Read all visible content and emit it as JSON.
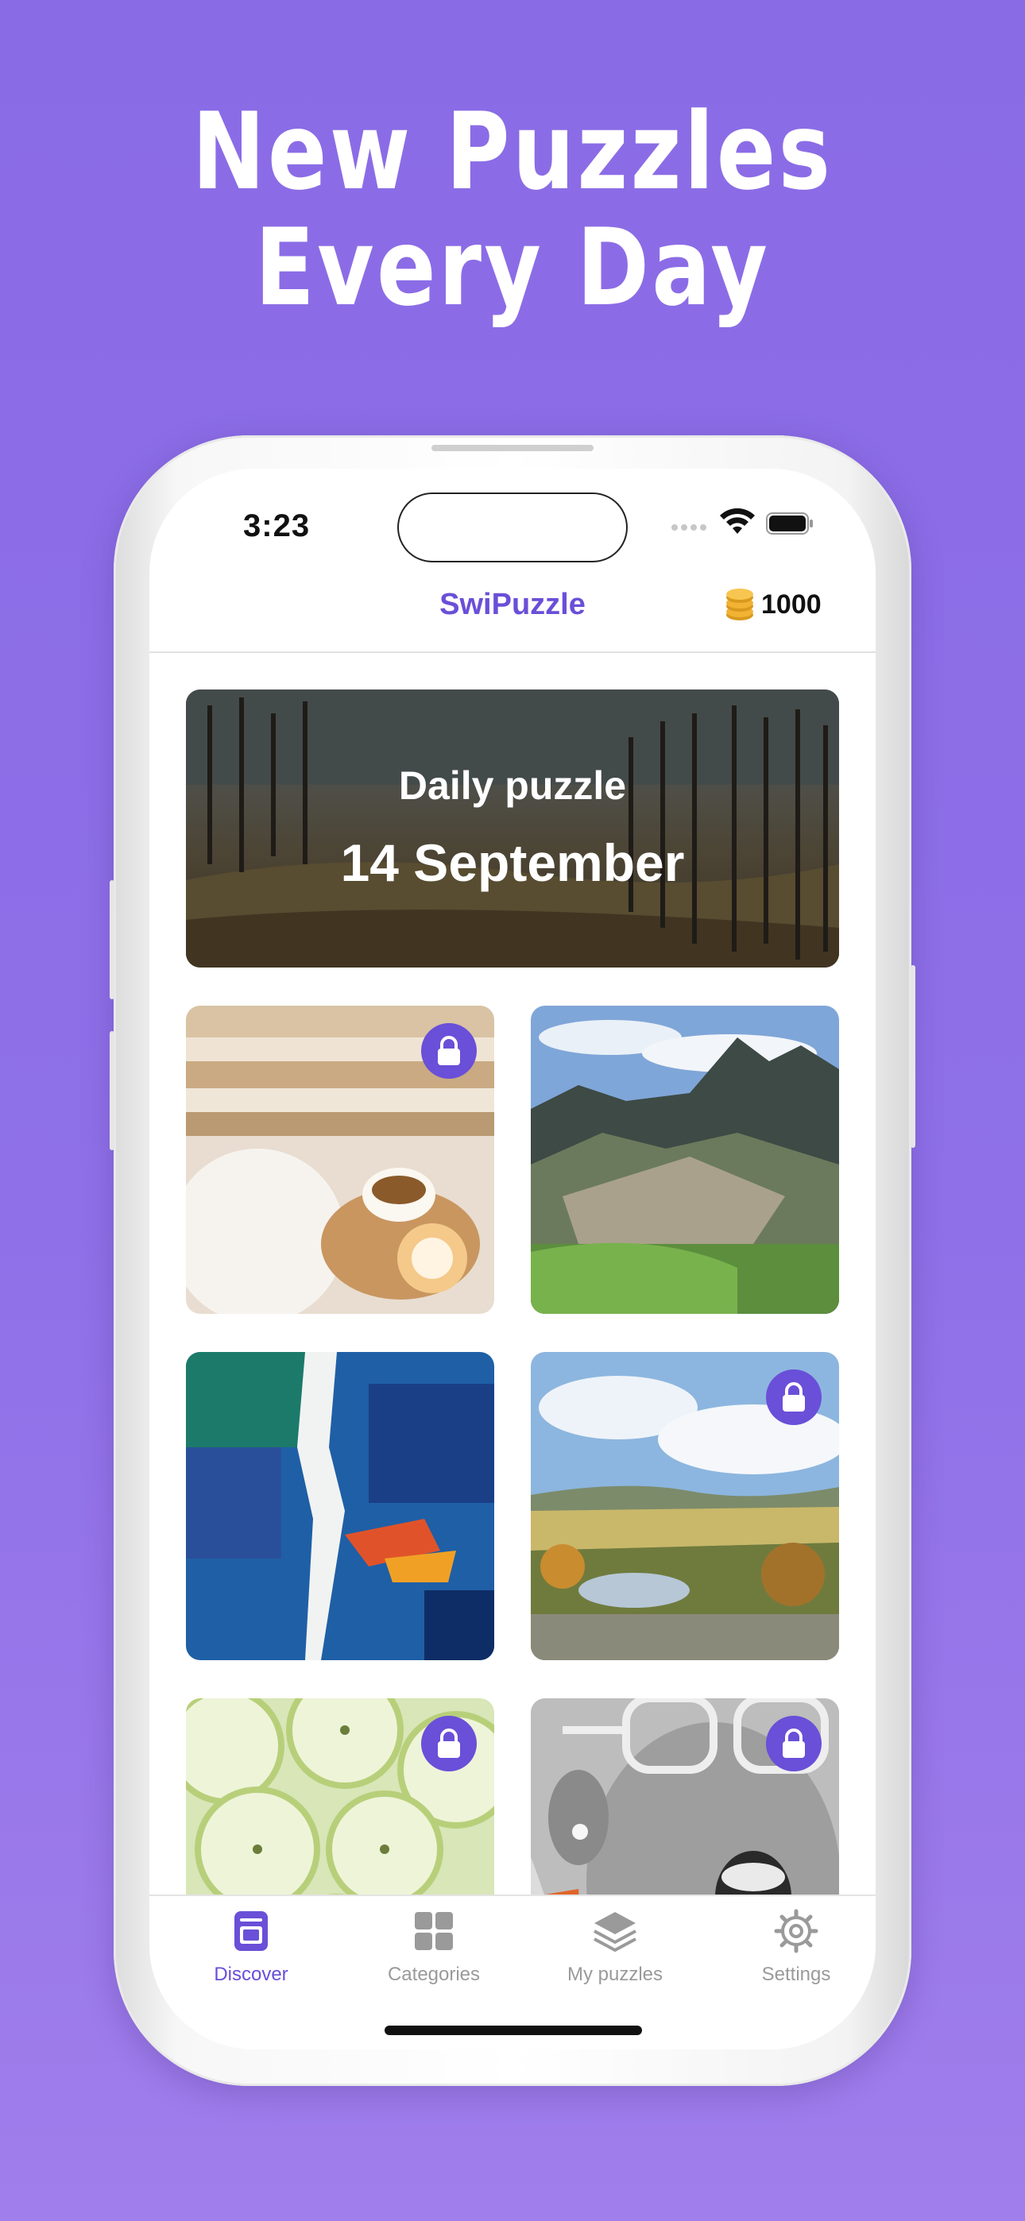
{
  "headline": {
    "line1": "New Puzzles",
    "line2": "Every Day"
  },
  "status_bar": {
    "time": "3:23"
  },
  "nav": {
    "title": "SwiPuzzle",
    "coin_count": "1000"
  },
  "banner": {
    "title": "Daily puzzle",
    "date": "14 September"
  },
  "puzzles": [
    {
      "name": "books-tea",
      "locked": true
    },
    {
      "name": "machu-picchu",
      "locked": false
    },
    {
      "name": "blue-paint",
      "locked": false
    },
    {
      "name": "valley-landscape",
      "locked": true
    },
    {
      "name": "kiwi-slices",
      "locked": true
    },
    {
      "name": "portrait-glasses",
      "locked": true
    }
  ],
  "tabs": [
    {
      "label": "Discover",
      "icon": "discover-icon",
      "active": true
    },
    {
      "label": "Categories",
      "icon": "grid-icon",
      "active": false
    },
    {
      "label": "My puzzles",
      "icon": "layers-icon",
      "active": false
    },
    {
      "label": "Settings",
      "icon": "gear-icon",
      "active": false
    }
  ],
  "colors": {
    "accent": "#6A4FD8",
    "background": "#8A6BE6",
    "inactive_tab": "#9a9a9a"
  }
}
